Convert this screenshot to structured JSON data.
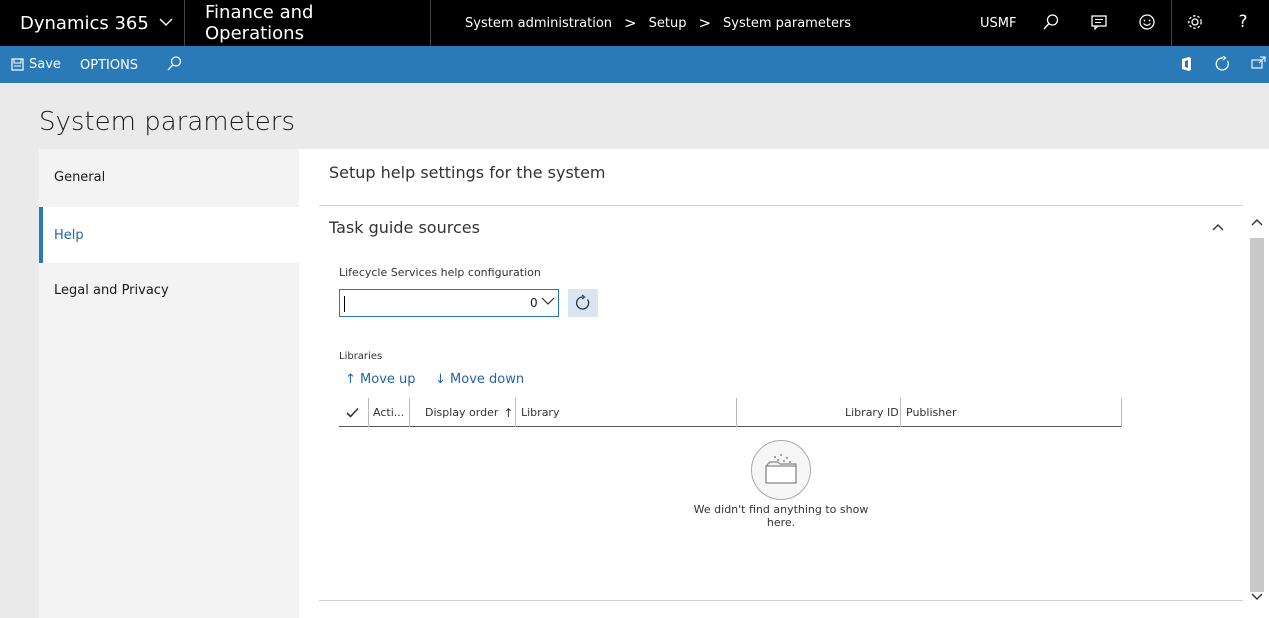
{
  "topbar": {
    "brand": "Dynamics 365",
    "module": "Finance and Operations",
    "breadcrumb": [
      "System administration",
      "Setup",
      "System parameters"
    ],
    "company": "USMF",
    "icons": [
      "search-icon",
      "messages-icon",
      "feedback-smiley-icon",
      "settings-gear-icon",
      "help-question-icon"
    ]
  },
  "actionbar": {
    "save_label": "Save",
    "options_label": "OPTIONS",
    "right_icons": [
      "office-icon",
      "refresh-icon",
      "open-new-window-icon"
    ]
  },
  "page": {
    "title": "System parameters"
  },
  "leftnav": {
    "items": [
      {
        "label": "General"
      },
      {
        "label": "Help"
      },
      {
        "label": "Legal and Privacy"
      }
    ],
    "active": "Help"
  },
  "content": {
    "subheading": "Setup help settings for the system",
    "fasttab_title": "Task guide sources",
    "lcs_label": "Lifecycle Services help configuration",
    "lcs_value": "0",
    "libraries_label": "Libraries",
    "move_up": "Move up",
    "move_down": "Move down",
    "grid": {
      "columns": [
        "Acti...",
        "Display order",
        "Library",
        "Library ID",
        "Publisher"
      ],
      "sort_indicator": "↑"
    },
    "empty_message": "We didn't find anything to show here."
  },
  "colors": {
    "topbar_bg": "#000000",
    "actionbar_bg": "#2a7ab8",
    "accent": "#2266aa",
    "page_bg": "#eaeaea"
  }
}
